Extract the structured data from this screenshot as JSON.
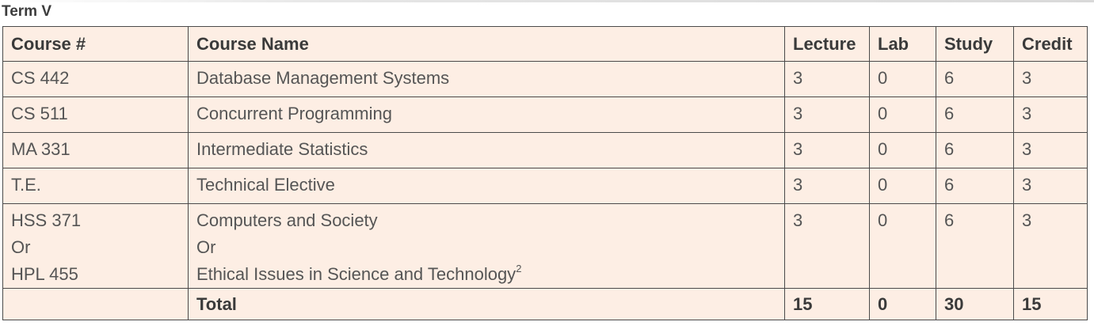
{
  "term_title": "Term V",
  "columns": [
    "Course #",
    "Course Name",
    "Lecture",
    "Lab",
    "Study",
    "Credit"
  ],
  "rows": [
    {
      "course_num": "CS 442",
      "course_name": "Database Management Systems",
      "lecture": "3",
      "lab": "0",
      "study": "6",
      "credit": "3"
    },
    {
      "course_num": "CS 511",
      "course_name": "Concurrent Programming",
      "lecture": "3",
      "lab": "0",
      "study": "6",
      "credit": "3"
    },
    {
      "course_num": "MA 331",
      "course_name": "Intermediate Statistics",
      "lecture": "3",
      "lab": "0",
      "study": "6",
      "credit": "3"
    },
    {
      "course_num": "T.E.",
      "course_name": "Technical Elective",
      "lecture": "3",
      "lab": "0",
      "study": "6",
      "credit": "3"
    }
  ],
  "choice_row": {
    "course_num_lines": [
      "HSS 371",
      "Or",
      "HPL 455"
    ],
    "course_name_lines": [
      "Computers and Society",
      "Or",
      "Ethical Issues in Science and Technology"
    ],
    "footnote_mark": "2",
    "lecture": "3",
    "lab": "0",
    "study": "6",
    "credit": "3"
  },
  "total": {
    "course_num": "",
    "label": "Total",
    "lecture": "15",
    "lab": "0",
    "study": "30",
    "credit": "15"
  },
  "colors": {
    "row_background": "#fdeee4",
    "border": "#4a4a4a",
    "text": "#555555",
    "header_text": "#3a3a3a"
  }
}
